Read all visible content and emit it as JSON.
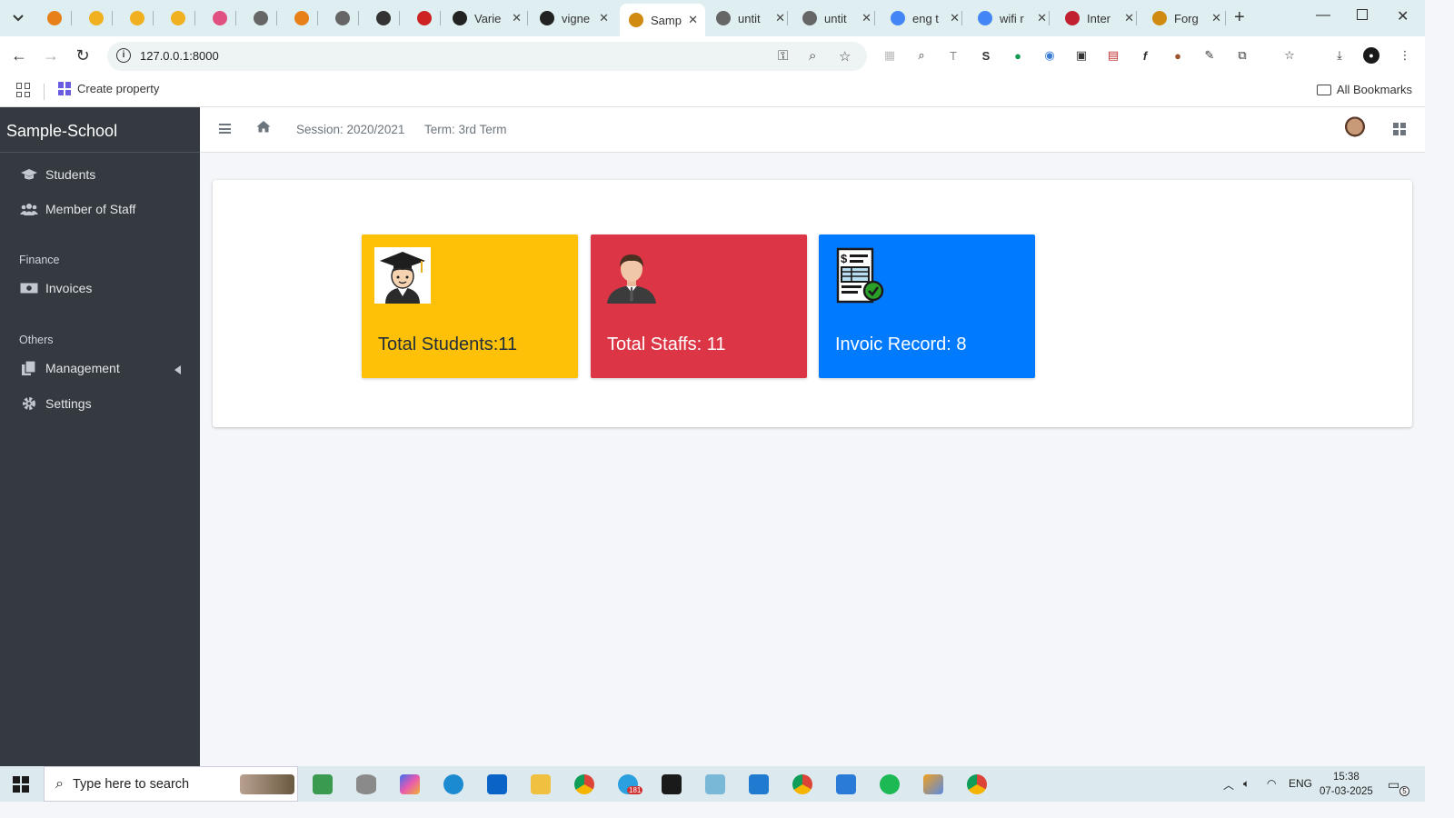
{
  "browser": {
    "tabs": [
      {
        "title": "",
        "favicon_color": "#e8801a"
      },
      {
        "title": "",
        "favicon_color": "#f0b020"
      },
      {
        "title": "",
        "favicon_color": "#f0b020"
      },
      {
        "title": "",
        "favicon_color": "#f0b020"
      },
      {
        "title": "",
        "favicon_color": "#e05080"
      },
      {
        "title": "",
        "favicon_color": "#666666"
      },
      {
        "title": "",
        "favicon_color": "#e8801a"
      },
      {
        "title": "",
        "favicon_color": "#666666"
      },
      {
        "title": "",
        "favicon_color": "#333333"
      },
      {
        "title": "",
        "favicon_color": "#cc2222"
      },
      {
        "title": "Varie",
        "favicon_color": "#222222"
      },
      {
        "title": "vigne",
        "favicon_color": "#222222"
      },
      {
        "title": "Samp",
        "favicon_color": "#d08a10",
        "active": true
      },
      {
        "title": "untit",
        "favicon_color": "#666666"
      },
      {
        "title": "untit",
        "favicon_color": "#666666"
      },
      {
        "title": "eng t",
        "favicon_color": "#4285f4"
      },
      {
        "title": "wifi r",
        "favicon_color": "#4285f4"
      },
      {
        "title": "Inter",
        "favicon_color": "#c02030"
      },
      {
        "title": "Forg",
        "favicon_color": "#d08a10"
      }
    ],
    "close_glyph": "✕",
    "new_tab": "+",
    "url": "127.0.0.1:8000",
    "bookmarks": {
      "item": "Create property",
      "all": "All Bookmarks"
    }
  },
  "app": {
    "brand": "Sample-School",
    "nav": {
      "students": "Students",
      "staff": "Member of Staff",
      "finance_header": "Finance",
      "invoices": "Invoices",
      "others_header": "Others",
      "management": "Management",
      "settings": "Settings"
    },
    "top": {
      "session": "Session: 2020/2021",
      "term": "Term: 3rd Term"
    },
    "cards": [
      {
        "label": "Total Students:11",
        "color": "#ffc107",
        "icon": "graduate-icon"
      },
      {
        "label": "Total Staffs: 11",
        "color": "#dc3545",
        "icon": "staff-person-icon"
      },
      {
        "label": "Invoic Record: 8",
        "color": "#007bff",
        "icon": "invoice-icon"
      }
    ]
  },
  "taskbar": {
    "search_placeholder": "Type here to search",
    "language": "ENG",
    "time": "15:38",
    "date": "07-03-2025",
    "telegram_badge": "181",
    "notifications": "5"
  }
}
